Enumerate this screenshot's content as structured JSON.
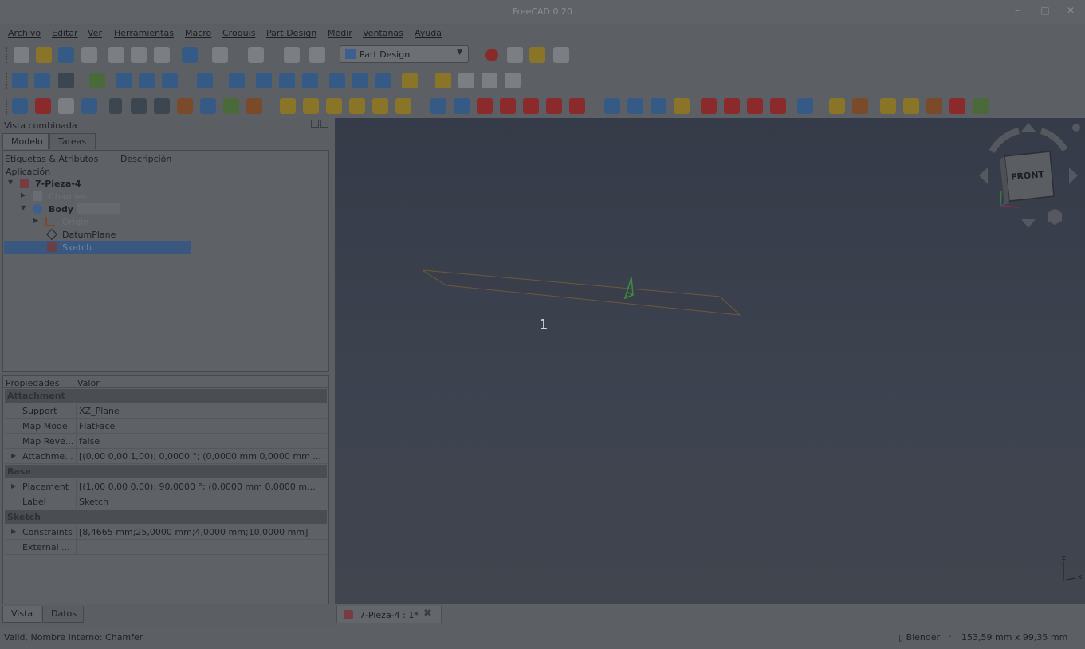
{
  "window": {
    "title": "FreeCAD 0.20"
  },
  "menu": [
    "Archivo",
    "Editar",
    "Ver",
    "Herramientas",
    "Macro",
    "Croquis",
    "Part Design",
    "Medir",
    "Ventanas",
    "Ayuda"
  ],
  "toolbar": {
    "workbench": "Part Design"
  },
  "combo": {
    "title": "Vista combinada",
    "tabs": [
      "Modelo",
      "Tareas"
    ],
    "tree_headers": [
      "Etiquetas & Atributos",
      "Descripción"
    ],
    "tree_root": "Aplicación",
    "tree": [
      {
        "label": "7-Pieza-4",
        "style": "bold"
      },
      {
        "label": "Chamfer",
        "style": "dim"
      },
      {
        "label": "Body",
        "style": "bold"
      },
      {
        "label": "Origin",
        "style": "dim"
      },
      {
        "label": "DatumPlane",
        "style": "normal"
      },
      {
        "label": "Sketch",
        "style": "selected"
      }
    ]
  },
  "properties": {
    "headers": [
      "Propiedades",
      "Valor"
    ],
    "groups": [
      {
        "name": "Attachment",
        "rows": [
          {
            "key": "Support",
            "value": "XZ_Plane"
          },
          {
            "key": "Map Mode",
            "value": "FlatFace"
          },
          {
            "key": "Map Reve...",
            "value": "false"
          },
          {
            "key": "Attachme...",
            "value": "[(0,00 0,00 1,00); 0,0000 °; (0,0000 mm  0,0000 mm ..."
          }
        ]
      },
      {
        "name": "Base",
        "rows": [
          {
            "key": "Placement",
            "value": "[(1,00 0,00 0,00); 90,0000 °; (0,0000 mm  0,0000 m..."
          },
          {
            "key": "Label",
            "value": "Sketch"
          }
        ]
      },
      {
        "name": "Sketch",
        "rows": [
          {
            "key": "Constraints",
            "value": "[8,4665 mm;25,0000 mm;4,0000 mm;10,0000 mm]"
          },
          {
            "key": "External ...",
            "value": ""
          }
        ]
      }
    ]
  },
  "bottom_tabs": [
    "Vista",
    "Datos"
  ],
  "view": {
    "annotation": "1",
    "navcube_face": "FRONT",
    "axis_z": "z",
    "axis_x": "x"
  },
  "document_tab": "7-Pieza-4 : 1*",
  "status": {
    "message": "Valid, Nombre interno: Chamfer",
    "navigation": "Blender",
    "dimensions": "153,59 mm x 99,35 mm"
  }
}
